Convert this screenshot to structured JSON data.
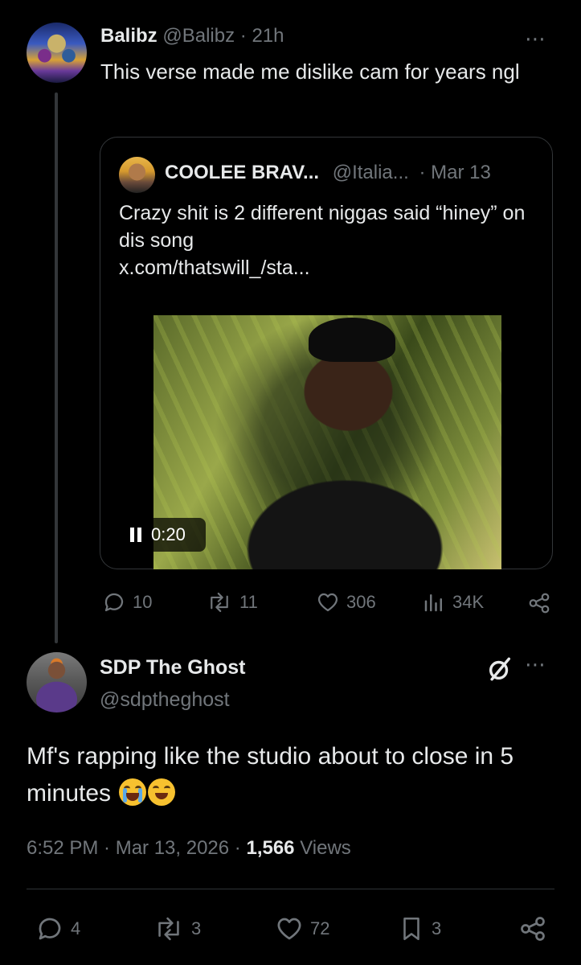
{
  "tweet": {
    "author_name": "Balibz",
    "author_handle": "@Balibz",
    "separator": "·",
    "time": "21h",
    "more_icon": "⋯",
    "text": "This verse made me dislike cam for years ngl",
    "quote": {
      "author_name": "COOLEE BRAV...",
      "author_handle": "@Italia...",
      "separator": "·",
      "date": "Mar 13",
      "text": "Crazy shit is 2 different niggas said “hiney” on dis song",
      "link": "x.com/thatswill_/sta...",
      "video_time": "0:20"
    },
    "actions": {
      "replies": "10",
      "reposts": "11",
      "likes": "306",
      "views": "34K"
    }
  },
  "reply": {
    "author_name": "SDP The Ghost",
    "author_handle": "@sdptheghost",
    "more_icon": "⋯",
    "text": "Mf's rapping like the studio about to close in 5 minutes",
    "timestamp": "6:52 PM · Mar 13, 2026 · ",
    "views_count": "1,566",
    "views_label": "Views",
    "actions": {
      "replies": "4",
      "reposts": "3",
      "likes": "72",
      "bookmarks": "3"
    }
  },
  "colors": {
    "background": "#000000",
    "text": "#e7e9ea",
    "muted": "#71767b",
    "border": "#333639"
  },
  "icons": [
    "more-icon",
    "reply-icon",
    "repost-icon",
    "like-icon",
    "views-icon",
    "share-icon",
    "bookmark-icon",
    "grok-icon",
    "pause-icon",
    "loudly-crying-face-emoji",
    "tears-of-joy-emoji"
  ]
}
